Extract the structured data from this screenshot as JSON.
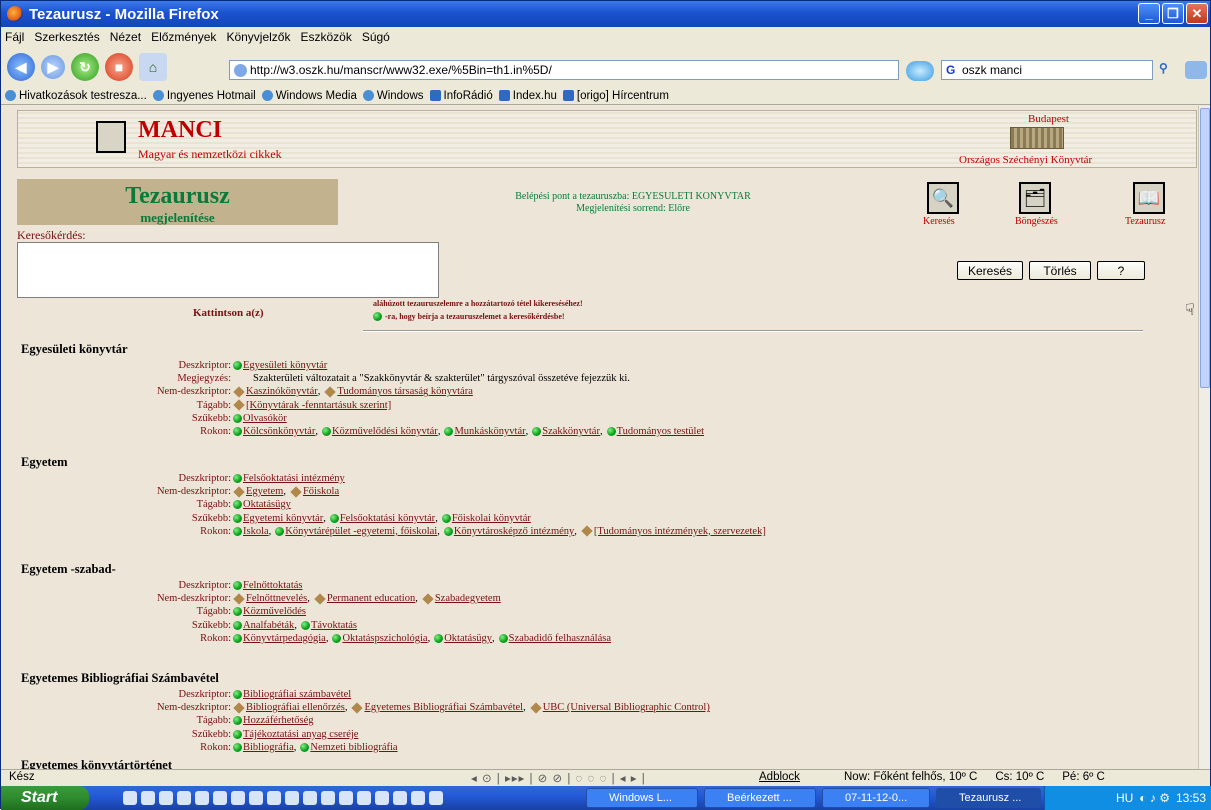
{
  "window": {
    "title": "Tezaurusz - Mozilla Firefox"
  },
  "menu": [
    "Fájl",
    "Szerkesztés",
    "Nézet",
    "Előzmények",
    "Könyvjelzők",
    "Eszközök",
    "Súgó"
  ],
  "url": "http://w3.oszk.hu/manscr/www32.exe/%5Bin=th1.in%5D/",
  "search_box": {
    "engine_letter": "G",
    "value": "oszk manci"
  },
  "bookmarks": [
    {
      "label": "Hivatkozások testresza...",
      "icon": "link-icon"
    },
    {
      "label": "Ingyenes Hotmail",
      "icon": "link-icon"
    },
    {
      "label": "Windows Media",
      "icon": "link-icon"
    },
    {
      "label": "Windows",
      "icon": "link-icon"
    },
    {
      "label": "InfoRádió",
      "icon": "rss-icon"
    },
    {
      "label": "Index.hu",
      "icon": "rss-icon"
    },
    {
      "label": "[origo] Hírcentrum",
      "icon": "rss-icon"
    }
  ],
  "header": {
    "title": "MANCI",
    "subtitle": "Magyar és nemzetközi cikkek",
    "city": "Budapest",
    "library": "Országos Széchényi Könyvtár"
  },
  "tezaurusz": {
    "title": "Tezaurusz",
    "subtitle": "megjelenítése",
    "entry_point": "Belépési pont a tezauruszba: EGYESULETI KONYVTAR",
    "order": "Megjelenítési sorrend: Előre",
    "icons": [
      {
        "label": "Keresés",
        "icon": "magnifier-icon"
      },
      {
        "label": "Böngészés",
        "icon": "card-catalog-icon"
      },
      {
        "label": "Tezaurusz",
        "icon": "book-icon"
      }
    ]
  },
  "query": {
    "label": "Keresőkérdés:",
    "value": ""
  },
  "buttons": {
    "search": "Keresés",
    "clear": "Törlés",
    "help": "?"
  },
  "hints": {
    "click": "Kattintson a(z)",
    "line1": "aláhúzott tezauruszelemre a hozzátartozó tétel kikereséséhez!",
    "line2": "-ra, hogy beírja a tezauruszelemet a keresőkérdésbe!"
  },
  "entries": [
    {
      "term": "Egyesületi könyvtár",
      "rows": [
        {
          "label": "Deszkriptor:",
          "items": [
            {
              "t": "Egyesületi könyvtár",
              "m": "g"
            }
          ]
        },
        {
          "label": "Megjegyzés:",
          "note": "Szakterületi változatait a \"Szakkönyvtár & szakterület\" tárgyszóval összetéve fejezzük ki."
        },
        {
          "label": "Nem-deszkriptor:",
          "items": [
            {
              "t": "Kaszinókönyvtár",
              "m": "d"
            },
            {
              "t": "Tudományos társaság könyvtára",
              "m": "d"
            }
          ]
        },
        {
          "label": "Tágabb:",
          "items": [
            {
              "t": "[Könyvtárak -fenntartásuk szerint]",
              "m": "d"
            }
          ]
        },
        {
          "label": "Szűkebb:",
          "items": [
            {
              "t": "Olvasókör",
              "m": "g"
            }
          ]
        },
        {
          "label": "Rokon:",
          "items": [
            {
              "t": "Kölcsönkönyvtár",
              "m": "g"
            },
            {
              "t": "Közművelődési könyvtár",
              "m": "g"
            },
            {
              "t": "Munkáskönyvtár",
              "m": "g"
            },
            {
              "t": "Szakkönyvtár",
              "m": "g"
            },
            {
              "t": "Tudományos testület",
              "m": "g"
            }
          ]
        }
      ]
    },
    {
      "term": "Egyetem",
      "rows": [
        {
          "label": "Deszkriptor:",
          "items": [
            {
              "t": "Felsőoktatási intézmény",
              "m": "g"
            }
          ]
        },
        {
          "label": "Nem-deszkriptor:",
          "items": [
            {
              "t": "Egyetem",
              "m": "d"
            },
            {
              "t": "Főiskola",
              "m": "d"
            }
          ]
        },
        {
          "label": "Tágabb:",
          "items": [
            {
              "t": "Oktatásügy",
              "m": "g"
            }
          ]
        },
        {
          "label": "Szűkebb:",
          "items": [
            {
              "t": "Egyetemi könyvtár",
              "m": "g"
            },
            {
              "t": "Felsőoktatási könyvtár",
              "m": "g"
            },
            {
              "t": "Főiskolai könyvtár",
              "m": "g"
            }
          ]
        },
        {
          "label": "Rokon:",
          "items": [
            {
              "t": "Iskola",
              "m": "g"
            },
            {
              "t": "Könyvtárépület -egyetemi, főiskolai",
              "m": "g"
            },
            {
              "t": "Könyvtárosképző intézmény",
              "m": "g"
            },
            {
              "t": "[Tudományos intézmények, szervezetek]",
              "m": "d"
            }
          ]
        }
      ]
    },
    {
      "term": "Egyetem -szabad-",
      "rows": [
        {
          "label": "Deszkriptor:",
          "items": [
            {
              "t": "Felnőttoktatás",
              "m": "g"
            }
          ]
        },
        {
          "label": "Nem-deszkriptor:",
          "items": [
            {
              "t": "Felnőttnevelés",
              "m": "d"
            },
            {
              "t": "Permanent education",
              "m": "d"
            },
            {
              "t": "Szabadegyetem",
              "m": "d"
            }
          ]
        },
        {
          "label": "Tágabb:",
          "items": [
            {
              "t": "Közművelődés",
              "m": "g"
            }
          ]
        },
        {
          "label": "Szűkebb:",
          "items": [
            {
              "t": "Analfabéták",
              "m": "g"
            },
            {
              "t": "Távoktatás",
              "m": "g"
            }
          ]
        },
        {
          "label": "Rokon:",
          "items": [
            {
              "t": "Könyvtárpedagógia",
              "m": "g"
            },
            {
              "t": "Oktatáspszichológia",
              "m": "g"
            },
            {
              "t": "Oktatásügy",
              "m": "g"
            },
            {
              "t": "Szabadidő felhasználása",
              "m": "g"
            }
          ]
        }
      ]
    },
    {
      "term": "Egyetemes Bibliográfiai Számbavétel",
      "rows": [
        {
          "label": "Deszkriptor:",
          "items": [
            {
              "t": "Bibliográfiai számbavétel",
              "m": "g"
            }
          ]
        },
        {
          "label": "Nem-deszkriptor:",
          "items": [
            {
              "t": "Bibliográfiai ellenőrzés",
              "m": "d"
            },
            {
              "t": "Egyetemes Bibliográfiai Számbavétel",
              "m": "d"
            },
            {
              "t": "UBC (Universal Bibliographic Control)",
              "m": "d"
            }
          ]
        },
        {
          "label": "Tágabb:",
          "items": [
            {
              "t": "Hozzáférhetőség",
              "m": "g"
            }
          ]
        },
        {
          "label": "Szűkebb:",
          "items": [
            {
              "t": "Tájékoztatási anyag cseréje",
              "m": "g"
            }
          ]
        },
        {
          "label": "Rokon:",
          "items": [
            {
              "t": "Bibliográfia",
              "m": "g"
            },
            {
              "t": "Nemzeti bibliográfia",
              "m": "g"
            }
          ]
        }
      ]
    },
    {
      "term": "Egyetemes könyvtártörténet",
      "rows": []
    }
  ],
  "status": {
    "ready": "Kész",
    "adblock": "Adblock",
    "weather_now": "Now: Főként felhős, 10º C",
    "weather_cs": "Cs: 10º C",
    "weather_pe": "Pé: 6º C"
  },
  "taskbar": {
    "start": "Start",
    "tasks": [
      "Windows L...",
      "Beérkezett ...",
      "07-11-12-0...",
      "Tezaurusz ..."
    ],
    "lang": "HU",
    "clock": "13:53"
  }
}
